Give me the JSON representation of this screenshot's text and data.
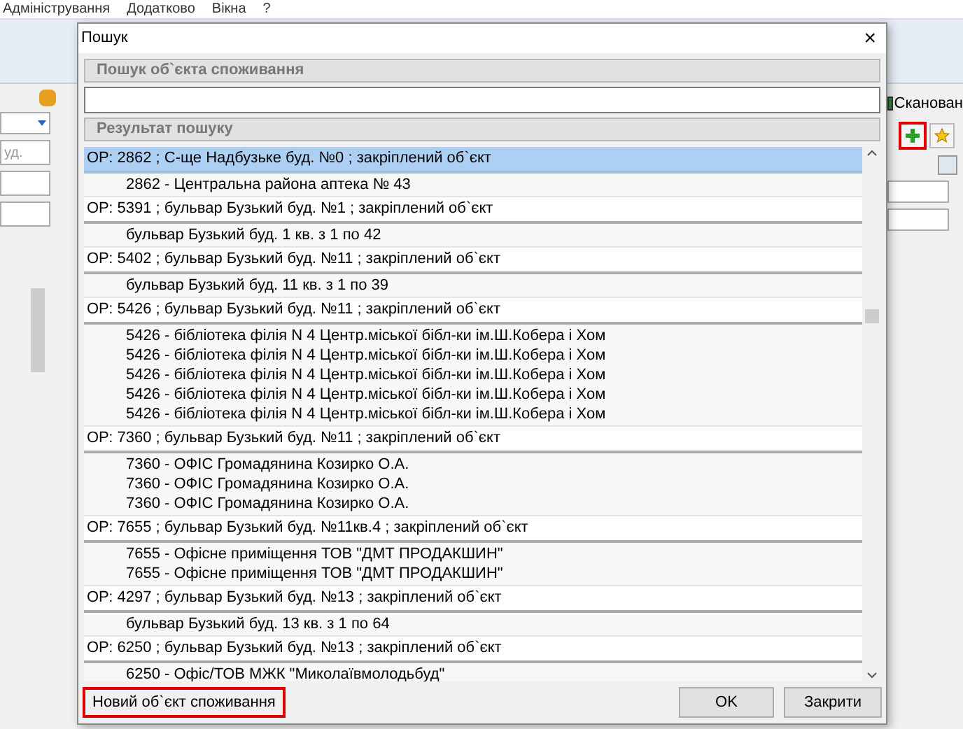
{
  "app": {
    "menu": [
      "Адміністрування",
      "Додатково",
      "Вікна",
      "?"
    ],
    "left_field": {
      "placeholder": "уд."
    },
    "right_label": "Сканован"
  },
  "dialog": {
    "title": "Пошук",
    "close": "×",
    "search_section": "Пошук об`єкта споживання",
    "results_section": "Результат пошуку",
    "results": [
      {
        "header": "ОР: 2862 ;   С-ще Надбузьке буд. №0 ; закріплений об`єкт",
        "selected": true,
        "items": [
          "2862 - Центральна района аптека № 43"
        ]
      },
      {
        "header": "ОР: 5391 ; бульвар Бузький буд. №1 ; закріплений об`єкт",
        "selected": false,
        "items": [
          "бульвар Бузький буд. 1 кв. з 1 по 42"
        ]
      },
      {
        "header": "ОР: 5402 ; бульвар Бузький буд. №11 ; закріплений об`єкт",
        "selected": false,
        "items": [
          "бульвар Бузький буд. 11 кв. з 1 по 39"
        ]
      },
      {
        "header": "ОР: 5426 ; бульвар Бузький буд. №11 ; закріплений об`єкт",
        "selected": false,
        "items": [
          "5426 - бібліотека філія N 4 Центр.міської бібл-ки ім.Ш.Кобера і Хом",
          "5426 - бібліотека філія N 4 Центр.міської бібл-ки ім.Ш.Кобера і Хом",
          "5426 - бібліотека філія N 4 Центр.міської бібл-ки ім.Ш.Кобера і Хом",
          "5426 - бібліотека філія N 4 Центр.міської бібл-ки ім.Ш.Кобера і Хом",
          "5426 - бібліотека філія N 4 Центр.міської бібл-ки ім.Ш.Кобера і Хом"
        ]
      },
      {
        "header": "ОР: 7360 ; бульвар Бузький буд. №11 ; закріплений об`єкт",
        "selected": false,
        "items": [
          "7360 - ОФІС Громадянина Козирко О.А.",
          "7360 - ОФІС Громадянина Козирко О.А.",
          "7360 - ОФІС Громадянина Козирко О.А."
        ]
      },
      {
        "header": "ОР: 7655 ; бульвар Бузький буд. №11кв.4 ; закріплений об`єкт",
        "selected": false,
        "items": [
          "7655 - Офісне приміщення ТОВ \"ДМТ ПРОДАКШИН\"",
          "7655 - Офісне приміщення ТОВ \"ДМТ ПРОДАКШИН\""
        ]
      },
      {
        "header": "ОР: 4297 ; бульвар Бузький буд. №13 ; закріплений об`єкт",
        "selected": false,
        "items": [
          "бульвар Бузький буд. 13 кв. з 1 по 64"
        ]
      },
      {
        "header": "ОР: 6250 ; бульвар Бузький буд. №13 ; закріплений об`єкт",
        "selected": false,
        "items": [
          "6250 - Офіс/ТОВ МЖК \"Миколаївмолодьбуд\""
        ]
      }
    ],
    "new_button": "Новий об`єкт споживання",
    "ok_button": "OK",
    "close_button": "Закрити"
  }
}
